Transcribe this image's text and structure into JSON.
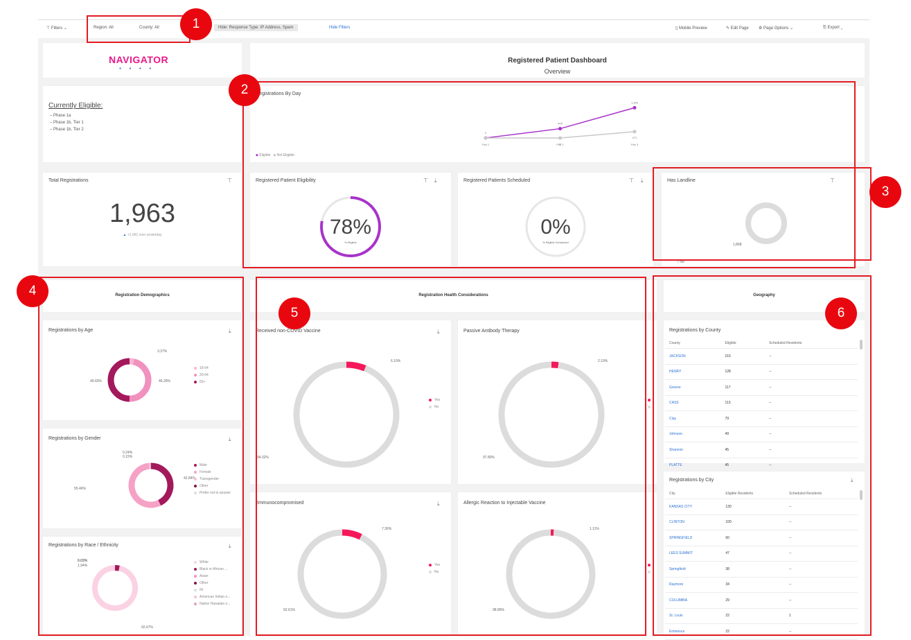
{
  "toolbar": {
    "filters_label": "Filters",
    "filter_region": "Region: All",
    "filter_county": "County: All",
    "filter_extra": "Hide: Response Type: IP Address, Spam",
    "hide_filters": "Hide Filters",
    "mobile_preview": "Mobile Preview",
    "edit_page": "Edit Page",
    "page_options": "Page Options",
    "export": "Export"
  },
  "logo": {
    "text": "NAVIGATOR"
  },
  "header": {
    "title": "Registered Patient Dashboard",
    "subtitle": "Overview"
  },
  "eligible": {
    "heading": "Currently Eligible:",
    "items": [
      "Phase 1a",
      "Phase 1b, Tier 1",
      "Phase 1b, Tier 2"
    ]
  },
  "registrations_by_day": {
    "title": "Registrations By Day",
    "legend": [
      "Eligible",
      "Not Eligible"
    ],
    "colors": {
      "eligible": "#a733c9",
      "not_eligible": "#c8c8c8"
    },
    "chart_data": {
      "type": "line",
      "categories": [
        "Feb 1",
        "Feb 2",
        "Feb 3"
      ],
      "series": [
        {
          "name": "Eligible",
          "values": [
            2,
            400,
            1300
          ],
          "labels": [
            "2",
            "405",
            "1,300"
          ]
        },
        {
          "name": "Not Eligible",
          "values": [
            0,
            1,
            271
          ],
          "labels": [
            "",
            "0",
            "271"
          ]
        }
      ],
      "ylim": [
        0,
        1400
      ]
    }
  },
  "total_registrations": {
    "title": "Total Registrations",
    "value": "1,963",
    "delta": "+1,961 over yesterday"
  },
  "eligibility": {
    "title": "Registered Patient Eligibility",
    "value": "78%",
    "caption": "% Eligible",
    "fraction": 0.78
  },
  "scheduled": {
    "title": "Registered Patients Scheduled",
    "value": "0%",
    "caption": "% Eligible Scheduled",
    "fraction": 0.0
  },
  "landline": {
    "title": "Has Landline",
    "value_label": "1,868",
    "legend": "No"
  },
  "sections": {
    "demographics": "Registration Demographics",
    "health": "Registration Health Considerations",
    "geography": "Geography"
  },
  "by_age": {
    "title": "Registrations by Age",
    "labels": [
      "3.37%",
      "46.29%",
      "49.60%"
    ],
    "legend": [
      "16-64",
      "20-64",
      "65+"
    ],
    "chart_data": {
      "type": "pie",
      "categories": [
        "16-64",
        "20-64",
        "65+"
      ],
      "values": [
        3.37,
        46.29,
        49.6
      ]
    }
  },
  "by_gender": {
    "title": "Registrations by Gender",
    "labels": [
      "0.24%",
      "0.15%",
      "55.46%",
      "42.84%"
    ],
    "legend": [
      "Male",
      "Female",
      "Transgender",
      "Other",
      "Prefer not to answer"
    ],
    "chart_data": {
      "type": "pie",
      "categories": [
        "Male",
        "Female",
        "Transgender",
        "Other",
        "Prefer not to answer"
      ],
      "values": [
        42.84,
        55.46,
        1.31,
        0.15,
        0.24
      ]
    }
  },
  "by_race": {
    "title": "Registrations by Race / Ethnicity",
    "labels": [
      "0.03%",
      "1.94%",
      "92.67%"
    ],
    "legend": [
      "White",
      "Black or African ...",
      "Asian",
      "Other",
      "NI",
      "American Indian o...",
      "Native Hawaiian o..."
    ]
  },
  "covid_vaccine": {
    "title": "Received non-COVID Vaccine",
    "labels": [
      "6.10%",
      "94.02%"
    ],
    "legend": [
      "Yes",
      "No"
    ],
    "chart_data": {
      "type": "pie",
      "categories": [
        "Yes",
        "No"
      ],
      "values": [
        6.1,
        94.02
      ]
    }
  },
  "antibody": {
    "title": "Passive Antibody Therapy",
    "labels": [
      "2.19%",
      "97.80%"
    ],
    "legend": [
      "Yes",
      "No"
    ],
    "chart_data": {
      "type": "pie",
      "categories": [
        "Yes",
        "No"
      ],
      "values": [
        2.19,
        97.8
      ]
    }
  },
  "immuno": {
    "title": "Immunocompromised",
    "labels": [
      "7.36%",
      "92.61%"
    ],
    "legend": [
      "Yes",
      "No"
    ],
    "chart_data": {
      "type": "pie",
      "categories": [
        "Yes",
        "No"
      ],
      "values": [
        7.36,
        92.61
      ]
    }
  },
  "allergic": {
    "title": "Allergic Reaction to Injectable Vaccine",
    "labels": [
      "1.11%",
      "98.89%"
    ],
    "legend": [
      "Yes",
      "No"
    ],
    "chart_data": {
      "type": "pie",
      "categories": [
        "Yes",
        "No"
      ],
      "values": [
        1.11,
        98.89
      ]
    }
  },
  "by_county": {
    "title": "Registrations by County",
    "columns": [
      "County",
      "Eligible",
      "Scheduled Residents"
    ],
    "rows": [
      [
        "JACKSON",
        "215",
        "--"
      ],
      [
        "HENRY",
        "128",
        "--"
      ],
      [
        "Greene",
        "117",
        "--"
      ],
      [
        "CASS",
        "113",
        "--"
      ],
      [
        "Clay",
        "79",
        "--"
      ],
      [
        "Johnson",
        "49",
        "--"
      ],
      [
        "Shannon",
        "45",
        "--"
      ],
      [
        "PLATTE",
        "45",
        "--"
      ]
    ]
  },
  "by_city": {
    "title": "Registrations by City",
    "columns": [
      "City",
      "Eligible Residents",
      "Scheduled Residents"
    ],
    "rows": [
      [
        "KANSAS CITY",
        "130",
        "--"
      ],
      [
        "CLINTON",
        "100",
        "--"
      ],
      [
        "SPRINGFIELD",
        "60",
        "--"
      ],
      [
        "LEES SUMMIT",
        "47",
        "--"
      ],
      [
        "Springfield",
        "38",
        "--"
      ],
      [
        "Raymore",
        "34",
        "--"
      ],
      [
        "COLUMBIA",
        "29",
        "--"
      ],
      [
        "St. Louis",
        "22",
        "1"
      ],
      [
        "Eminence",
        "22",
        "--"
      ]
    ]
  },
  "annotations": [
    "1",
    "2",
    "3",
    "4",
    "5",
    "6"
  ],
  "colors": {
    "accent": "#a733c9",
    "annotation": "#e8070f",
    "pink": "#f4a3c7",
    "dark_pink": "#a3195b",
    "hot": "#f5185a"
  }
}
